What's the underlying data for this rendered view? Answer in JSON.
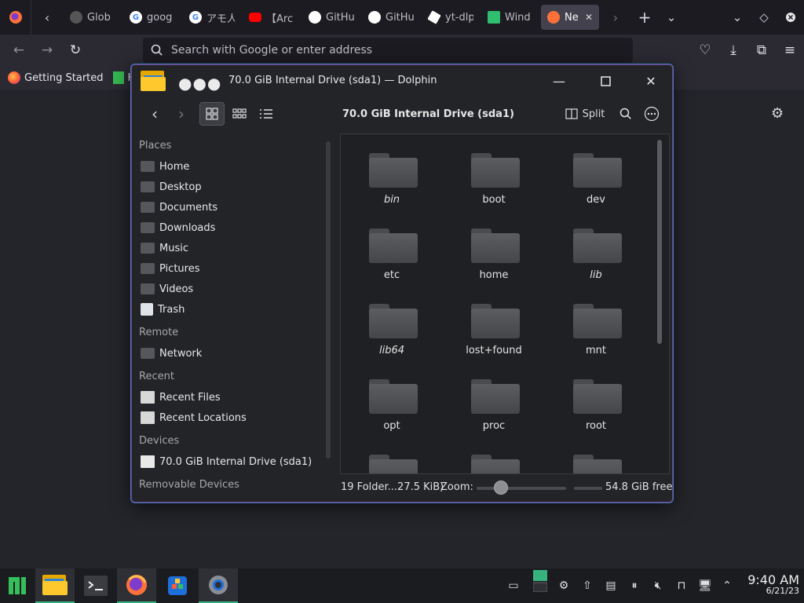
{
  "browser": {
    "tabs": [
      {
        "label": "Glob",
        "icon": "github-dark-icon",
        "color": "#555555"
      },
      {
        "label": "goog",
        "icon": "google-icon",
        "color": "#ffffff"
      },
      {
        "label": "アモ人",
        "icon": "google-icon",
        "color": "#ffffff"
      },
      {
        "label": "【Arc",
        "icon": "youtube-icon",
        "color": "#ff0000"
      },
      {
        "label": "GitHu",
        "icon": "github-icon",
        "color": "#ffffff"
      },
      {
        "label": "GitHu",
        "icon": "github-icon",
        "color": "#ffffff"
      },
      {
        "label": "yt-dlp",
        "icon": "cube-icon",
        "color": "#ffffff"
      },
      {
        "label": "Wind",
        "icon": "spreadsheet-icon",
        "color": "#2fbd6f"
      },
      {
        "label": "Ne",
        "icon": "firefox-icon",
        "color": "#ff7139",
        "active": true
      }
    ],
    "url_placeholder": "Search with Google or enter address",
    "bookmarks": [
      {
        "label": "Getting Started"
      },
      {
        "label": "H"
      }
    ]
  },
  "dolphin": {
    "title": "70.0 GiB Internal Drive (sda1) — Dolphin",
    "breadcrumb": "70.0 GiB Internal Drive (sda1)",
    "split_label": "Split",
    "places": {
      "places_header": "Places",
      "places_items": [
        "Home",
        "Desktop",
        "Documents",
        "Downloads",
        "Music",
        "Pictures",
        "Videos",
        "Trash"
      ],
      "remote_header": "Remote",
      "remote_items": [
        "Network"
      ],
      "recent_header": "Recent",
      "recent_items": [
        "Recent Files",
        "Recent Locations"
      ],
      "devices_header": "Devices",
      "devices_items": [
        "70.0 GiB Internal Drive (sda1)"
      ],
      "removable_header": "Removable Devices"
    },
    "folders": [
      {
        "name": "bin",
        "italic": true
      },
      {
        "name": "boot",
        "italic": false
      },
      {
        "name": "dev",
        "italic": false
      },
      {
        "name": "etc",
        "italic": false
      },
      {
        "name": "home",
        "italic": false
      },
      {
        "name": "lib",
        "italic": true
      },
      {
        "name": "lib64",
        "italic": true
      },
      {
        "name": "lost+found",
        "italic": false
      },
      {
        "name": "mnt",
        "italic": false
      },
      {
        "name": "opt",
        "italic": false
      },
      {
        "name": "proc",
        "italic": false
      },
      {
        "name": "root",
        "italic": false
      },
      {
        "name": "",
        "italic": false
      },
      {
        "name": "",
        "italic": false
      },
      {
        "name": "",
        "italic": false
      }
    ],
    "status": {
      "summary": "19 Folder...27.5 KiB)",
      "zoom_label": "Zoom:",
      "free": "54.8 GiB free"
    }
  },
  "taskbar": {
    "time": "9:40 AM",
    "date": "6/21/23"
  },
  "colors": {
    "accent": "#36b37e",
    "window_border": "#3d7fb8",
    "folder_yellow": "#ffc82c"
  }
}
